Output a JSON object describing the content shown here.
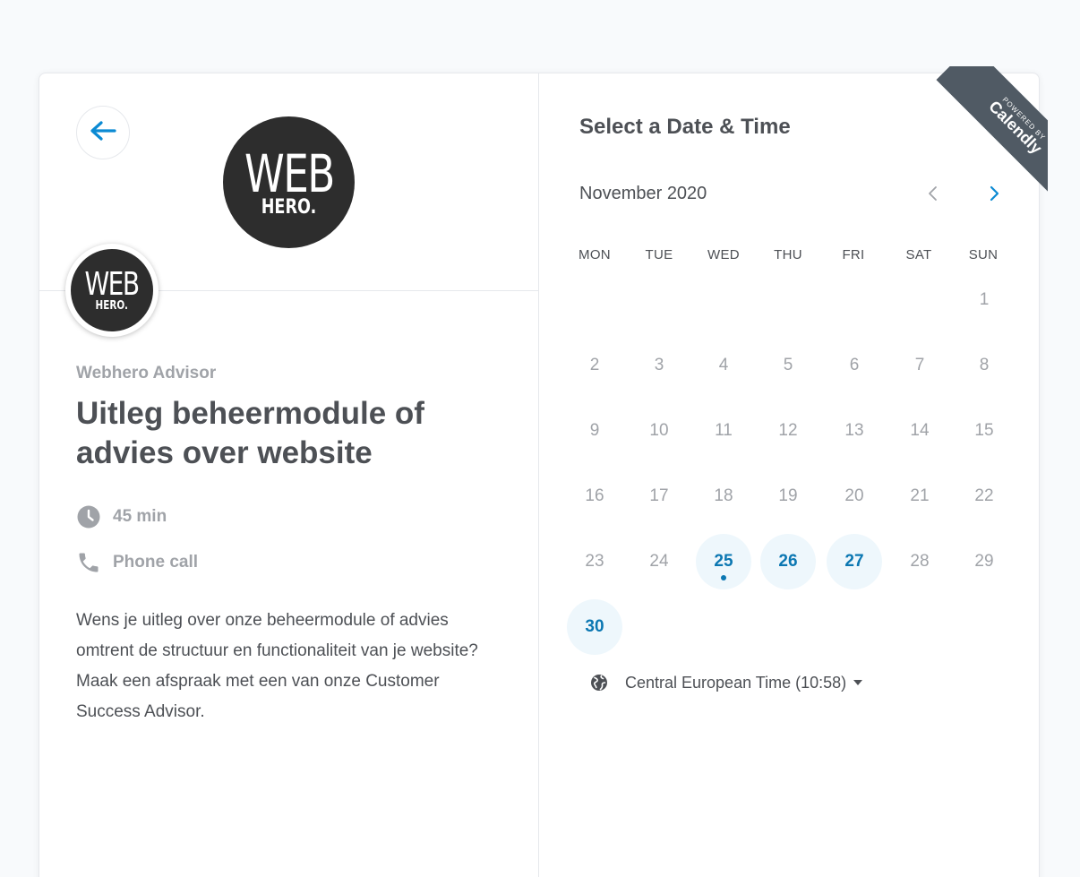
{
  "event": {
    "organizer": "Webhero Advisor",
    "title": "Uitleg beheermodule of advies over website",
    "duration": "45 min",
    "location": "Phone call",
    "description": "Wens je uitleg over onze beheermodule of advies omtrent de structuur en functionaliteit van je website? Maak een afspraak met een van onze Customer Success Advisor."
  },
  "logo": {
    "line1": "WEB",
    "line2": "HERO."
  },
  "calendar": {
    "heading": "Select a Date & Time",
    "month_label": "November 2020",
    "weekdays": [
      "MON",
      "TUE",
      "WED",
      "THU",
      "FRI",
      "SAT",
      "SUN"
    ],
    "days": [
      {
        "label": "1",
        "available": false
      },
      {
        "label": "2",
        "available": false
      },
      {
        "label": "3",
        "available": false
      },
      {
        "label": "4",
        "available": false
      },
      {
        "label": "5",
        "available": false
      },
      {
        "label": "6",
        "available": false
      },
      {
        "label": "7",
        "available": false
      },
      {
        "label": "8",
        "available": false
      },
      {
        "label": "9",
        "available": false
      },
      {
        "label": "10",
        "available": false
      },
      {
        "label": "11",
        "available": false
      },
      {
        "label": "12",
        "available": false
      },
      {
        "label": "13",
        "available": false
      },
      {
        "label": "14",
        "available": false
      },
      {
        "label": "15",
        "available": false
      },
      {
        "label": "16",
        "available": false
      },
      {
        "label": "17",
        "available": false
      },
      {
        "label": "18",
        "available": false
      },
      {
        "label": "19",
        "available": false
      },
      {
        "label": "20",
        "available": false
      },
      {
        "label": "21",
        "available": false
      },
      {
        "label": "22",
        "available": false
      },
      {
        "label": "23",
        "available": false
      },
      {
        "label": "24",
        "available": false
      },
      {
        "label": "25",
        "available": true,
        "today": true
      },
      {
        "label": "26",
        "available": true
      },
      {
        "label": "27",
        "available": true
      },
      {
        "label": "28",
        "available": false
      },
      {
        "label": "29",
        "available": false
      },
      {
        "label": "30",
        "available": true
      }
    ],
    "timezone": "Central European Time (10:58)"
  },
  "badge": {
    "small": "POWERED BY",
    "brand": "Calendly"
  },
  "colors": {
    "accent": "#0b77b2",
    "available_bg": "#eef7fc",
    "ribbon": "#505a64"
  },
  "icons": {
    "back": "arrow-left-icon",
    "duration": "clock-icon",
    "location": "phone-icon",
    "timezone": "globe-icon",
    "prev": "chevron-left-icon",
    "next": "chevron-right-icon"
  }
}
